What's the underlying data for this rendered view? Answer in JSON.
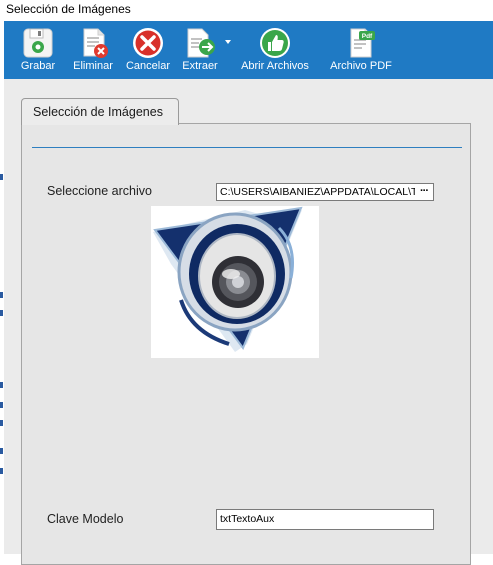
{
  "window": {
    "title": "Selección de Imágenes"
  },
  "toolbar": {
    "buttons": [
      {
        "label": "Grabar",
        "icon": "save-icon"
      },
      {
        "label": "Eliminar",
        "icon": "delete-document-icon"
      },
      {
        "label": "Cancelar",
        "icon": "cancel-icon"
      },
      {
        "label": "Extraer",
        "icon": "extract-icon"
      },
      {
        "label": "Abrir Archivos",
        "icon": "thumbs-up-icon"
      },
      {
        "label": "Archivo PDF",
        "icon": "pdf-file-icon"
      }
    ],
    "pdf_badge": "Pdf"
  },
  "tab": {
    "label": "Selección de Imágenes"
  },
  "form": {
    "file_label": "Seleccione archivo",
    "file_value": "C:\\USERS\\AIBANIEZ\\APPDATA\\LOCAL\\TEMP\\",
    "browse_label": "···",
    "model_label": "Clave Modelo",
    "model_value": "txtTextoAux"
  },
  "colors": {
    "toolbar": "#1f7ac4",
    "panel": "#e6e6e6",
    "separator": "#2e7fc0"
  }
}
